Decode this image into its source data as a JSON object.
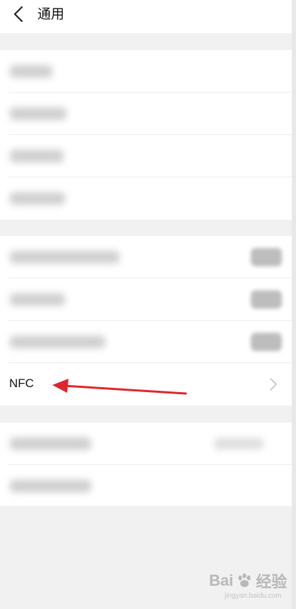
{
  "header": {
    "title": "通用",
    "back_icon": "chevron-left-icon"
  },
  "group1": {
    "items": [
      {
        "label_blurred": true,
        "chevron_blurred": true
      },
      {
        "label_blurred": true,
        "chevron_blurred": true
      },
      {
        "label_blurred": true,
        "chevron_blurred": true
      },
      {
        "label_blurred": true,
        "chevron_blurred": true
      }
    ]
  },
  "group2": {
    "items": [
      {
        "label_blurred": true,
        "toggle": true
      },
      {
        "label_blurred": true,
        "toggle": true
      },
      {
        "label_blurred": true,
        "toggle": true
      },
      {
        "label": "NFC",
        "chevron": true
      }
    ]
  },
  "group3": {
    "items": [
      {
        "label_blurred": true,
        "value_blurred": true
      },
      {
        "label_blurred": true
      }
    ]
  },
  "annotation": {
    "arrow_color": "#e0262b",
    "points_to": "NFC"
  },
  "watermark": {
    "brand": "Bai",
    "brand_end": "经验",
    "sub": "jingyan.baidu.com"
  }
}
